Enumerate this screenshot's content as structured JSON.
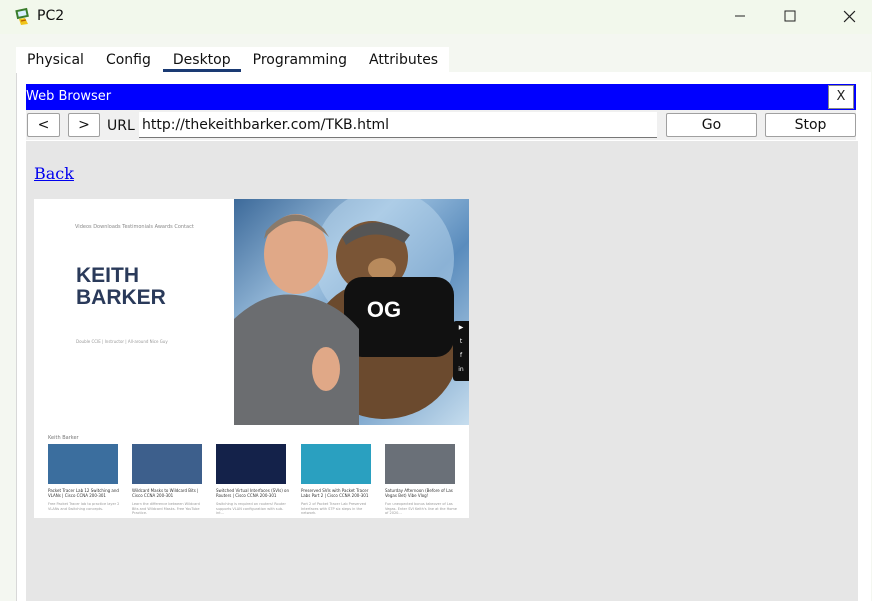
{
  "window": {
    "title": "PC2",
    "icon": "pc-icon"
  },
  "tabs": [
    {
      "label": "Physical",
      "active": false
    },
    {
      "label": "Config",
      "active": false
    },
    {
      "label": "Desktop",
      "active": true
    },
    {
      "label": "Programming",
      "active": false
    },
    {
      "label": "Attributes",
      "active": false
    }
  ],
  "browser": {
    "title": "Web Browser",
    "close_label": "X",
    "back_label": "<",
    "forward_label": ">",
    "url_label": "URL",
    "url_value": "http://thekeithbarker.com/TKB.html",
    "go_label": "Go",
    "stop_label": "Stop"
  },
  "page": {
    "back_link": "Back",
    "image": {
      "nav": "Videos    Downloads    Testimonials    Awards    Contact",
      "name_line1": "KEITH",
      "name_line2": "BARKER",
      "tagline": "Double CCIE | Instructor | All-around Nice Guy",
      "videos_heading": "Keith Barker",
      "social": [
        "youtube-icon",
        "twitter-icon",
        "facebook-icon",
        "linkedin-icon"
      ],
      "videos": [
        {
          "caption": "Packet Tracer Lab 12 Switching and VLANs | Cisco CCNA 200-301",
          "desc": "Free Packet Tracer lab to practice layer 2 VLANs and Switching concepts.",
          "color": "#3b6e9e"
        },
        {
          "caption": "Wildcard Masks to Wildcard Bits | Cisco CCNA 200-301",
          "desc": "Learn the difference between Wildcard Bits and Wildcard Masks. Free YouTube Practice.",
          "color": "#3d5f8c"
        },
        {
          "caption": "Switched Virtual Interfaces (SVIs) on Routers | Cisco CCNA 200-301",
          "desc": "Switching is required on routers! Router supports VLAN configuration with sub-int...",
          "color": "#14224a"
        },
        {
          "caption": "Preserved SVIs with Packet Tracer Labs Part 2 | Cisco CCNA 200-301",
          "desc": "Part 2 of Packet Tracer Lab Preserved Interfaces with STP six steps in the network.",
          "color": "#2aa0c0"
        },
        {
          "caption": "Saturday Afternoon (Before of Las Vegas Bet) Vibe Vlog!",
          "desc": "Fun unexpected bonus takeover of Las Vegas. Enter SVI Keith's line at the Home of 2020...",
          "color": "#6a7078"
        }
      ]
    }
  },
  "colors": {
    "browser_header": "#0000ff",
    "active_tab_underline": "#1a3a73",
    "link": "#0000ee",
    "name": "#2a3a5a"
  }
}
